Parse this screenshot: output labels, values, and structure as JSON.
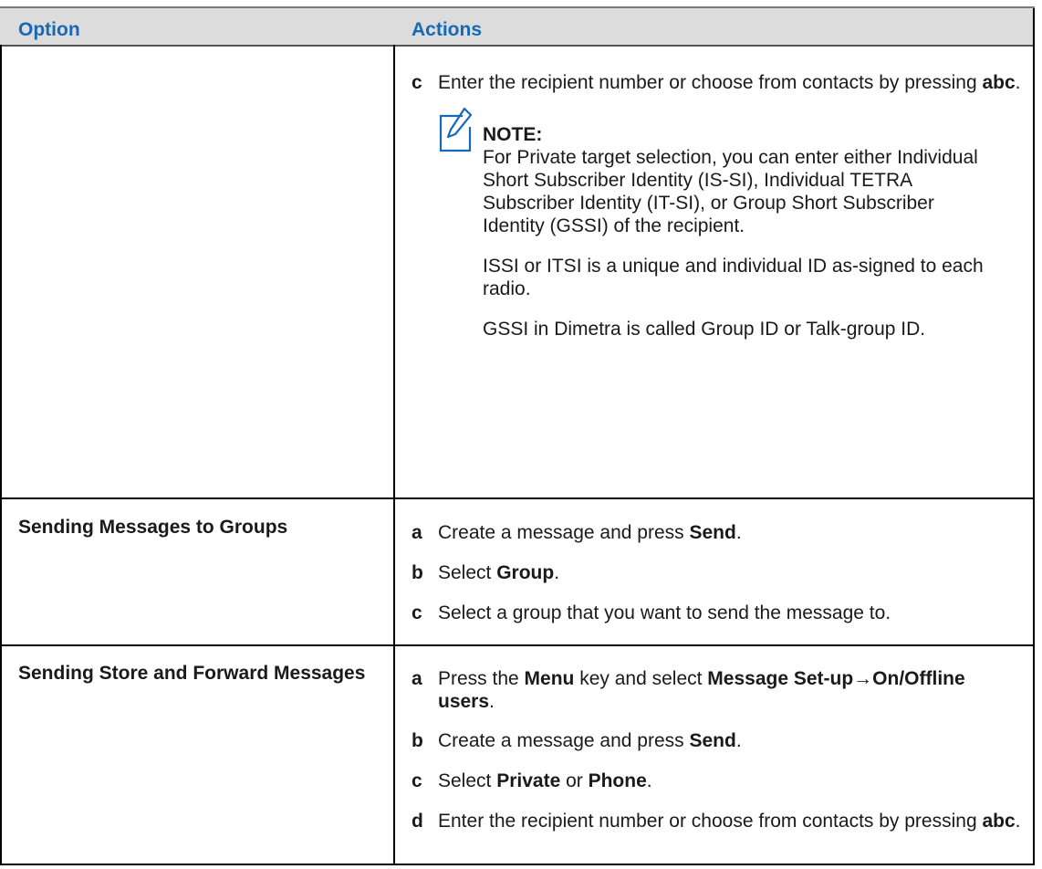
{
  "header": {
    "col_option": "Option",
    "col_actions": "Actions"
  },
  "row1": {
    "option": "",
    "step_c": {
      "letter": "c",
      "text_before": "Enter the recipient number or choose from contacts by pressing ",
      "bold": "abc",
      "text_after": "."
    },
    "note": {
      "title": "NOTE:",
      "p1": "For Private target selection, you can enter either Individual Short Subscriber Identity (IS-SI), Individual TETRA Subscriber Identity (IT-SI), or Group Short Subscriber Identity (GSSI) of the recipient.",
      "p2": "ISSI or ITSI is a unique and individual ID as-signed to each radio.",
      "p3": "GSSI in Dimetra is called Group ID or Talk-group ID."
    }
  },
  "row2": {
    "option": "Sending Messages to Groups",
    "steps": [
      {
        "letter": "a",
        "t1": "Create a message and press ",
        "b1": "Send",
        "t2": "."
      },
      {
        "letter": "b",
        "t1": "Select ",
        "b1": "Group",
        "t2": "."
      },
      {
        "letter": "c",
        "t1": "Select a group that you want to send the message to.",
        "b1": "",
        "t2": ""
      }
    ]
  },
  "row3": {
    "option": "Sending Store and Forward Messages",
    "steps": [
      {
        "letter": "a",
        "t1": "Press the ",
        "b1": "Menu",
        "t2": " key and select ",
        "b2": "Message Set-up→On/Offline users",
        "t3": "."
      },
      {
        "letter": "b",
        "t1": "Create a message and press ",
        "b1": "Send",
        "t2": "."
      },
      {
        "letter": "c",
        "t1": "Select ",
        "b1": "Private",
        "t2": " or ",
        "b2": "Phone",
        "t3": "."
      },
      {
        "letter": "d",
        "t1": "Enter the recipient number or choose from contacts by pressing ",
        "b1": "abc",
        "t2": "."
      }
    ]
  },
  "colors": {
    "header_bg": "#dcdcdc",
    "header_text": "#1769b6",
    "note_icon": "#1769b6"
  }
}
